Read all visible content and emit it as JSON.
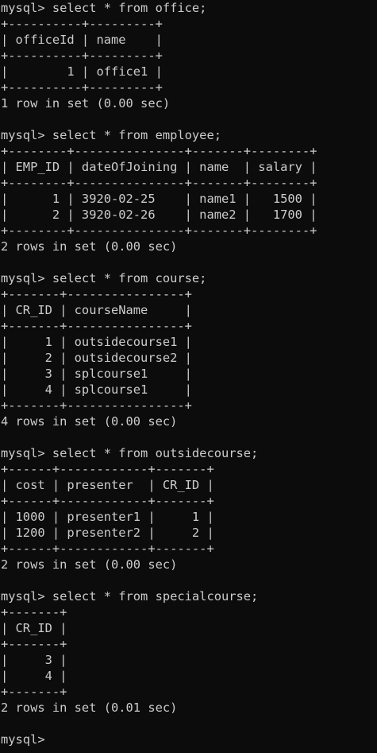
{
  "terminal": {
    "prompt": "mysql>",
    "background": "#0c0c0c",
    "foreground": "#cccccc",
    "lines": [
      "mysql> select * from office;",
      "+----------+---------+",
      "| officeId | name    |",
      "+----------+---------+",
      "|        1 | office1 |",
      "+----------+---------+",
      "1 row in set (0.00 sec)",
      "",
      "mysql> select * from employee;",
      "+--------+---------------+-------+--------+",
      "| EMP_ID | dateOfJoining | name  | salary |",
      "+--------+---------------+-------+--------+",
      "|      1 | 3920-02-25    | name1 |   1500 |",
      "|      2 | 3920-02-26    | name2 |   1700 |",
      "+--------+---------------+-------+--------+",
      "2 rows in set (0.00 sec)",
      "",
      "mysql> select * from course;",
      "+-------+----------------+",
      "| CR_ID | courseName     |",
      "+-------+----------------+",
      "|     1 | outsidecourse1 |",
      "|     2 | outsidecourse2 |",
      "|     3 | splcourse1     |",
      "|     4 | splcourse1     |",
      "+-------+----------------+",
      "4 rows in set (0.00 sec)",
      "",
      "mysql> select * from outsidecourse;",
      "+------+------------+-------+",
      "| cost | presenter  | CR_ID |",
      "+------+------------+-------+",
      "| 1000 | presenter1 |     1 |",
      "| 1200 | presenter2 |     2 |",
      "+------+------------+-------+",
      "2 rows in set (0.00 sec)",
      "",
      "mysql> select * from specialcourse;",
      "+-------+",
      "| CR_ID |",
      "+-------+",
      "|     3 |",
      "|     4 |",
      "+-------+",
      "2 rows in set (0.01 sec)",
      "",
      "mysql>"
    ]
  }
}
